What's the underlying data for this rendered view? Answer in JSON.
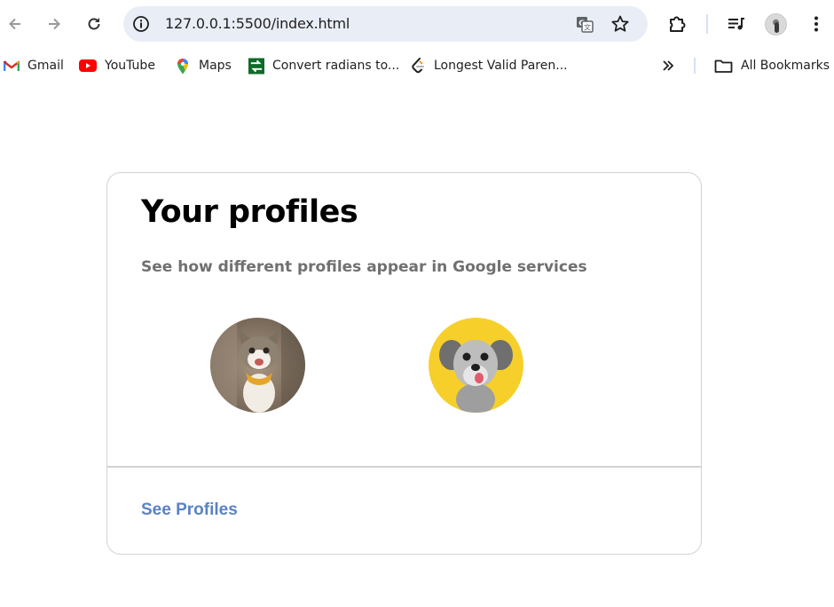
{
  "browser": {
    "url": "127.0.0.1:5500/index.html",
    "icons": {
      "back": "arrow-left-icon",
      "forward": "arrow-right-icon",
      "reload": "reload-icon",
      "site_info": "info-icon",
      "translate": "translate-icon",
      "bookmark": "star-icon",
      "extensions": "puzzle-icon",
      "media": "playlist-icon",
      "menu": "kebab-menu-icon"
    }
  },
  "bookmarks": {
    "items": [
      {
        "label": "Gmail",
        "icon": "gmail-icon"
      },
      {
        "label": "YouTube",
        "icon": "youtube-icon"
      },
      {
        "label": "Maps",
        "icon": "maps-pin-icon"
      },
      {
        "label": "Convert radians to...",
        "icon": "convert-icon"
      },
      {
        "label": "Longest Valid Paren...",
        "icon": "leetcode-icon"
      }
    ],
    "overflow_icon": "chevron-double-right-icon",
    "all_bookmarks": "All Bookmarks"
  },
  "card": {
    "title": "Your profiles",
    "subtitle": "See how different profiles appear in Google services",
    "profiles": [
      {
        "alt": "cat",
        "bg": "#8a7d6e"
      },
      {
        "alt": "dog",
        "bg": "#f6cf2a"
      }
    ],
    "link_label": "See Profiles",
    "link_color": "#5b82c2"
  }
}
